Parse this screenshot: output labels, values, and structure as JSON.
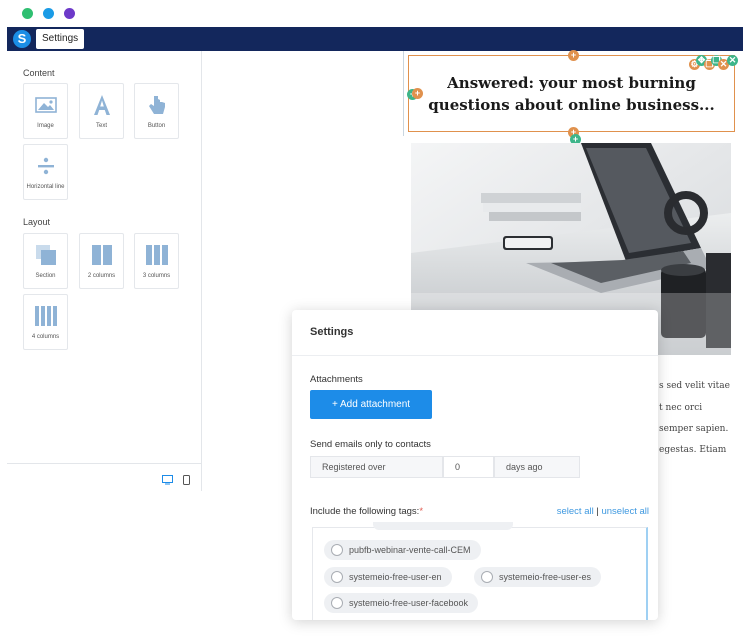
{
  "window": {
    "dots": [
      {
        "name": "green-dot",
        "color": "#2fbf71"
      },
      {
        "name": "blue-dot",
        "color": "#1a9be6"
      },
      {
        "name": "purple-dot",
        "color": "#6d39c9"
      }
    ]
  },
  "topbar": {
    "logo_letter": "S",
    "tab_label": "Settings",
    "color": "#13275c"
  },
  "sidebar": {
    "content_title": "Content",
    "content_blocks": [
      {
        "label": "Image",
        "icon": "image-icon"
      },
      {
        "label": "Text",
        "icon": "text-icon"
      },
      {
        "label": "Button",
        "icon": "pointer-icon"
      },
      {
        "label": "Horizontal line",
        "icon": "divider-icon"
      }
    ],
    "layout_title": "Layout",
    "layout_blocks": [
      {
        "label": "Section",
        "icon": "section-icon"
      },
      {
        "label": "2 columns",
        "icon": "two-columns-icon"
      },
      {
        "label": "3 columns",
        "icon": "three-columns-icon"
      },
      {
        "label": "4 columns",
        "icon": "four-columns-icon"
      }
    ],
    "footer_icons": [
      "desktop-icon",
      "mobile-icon"
    ]
  },
  "canvas": {
    "headline": "Answered: your most burning questions about online business...",
    "body_fragments": [
      "s sed velit vitae",
      "t nec orci",
      "semper sapien.",
      "egestas. Etiam"
    ],
    "accent_color": "#e0914d"
  },
  "settings_modal": {
    "title": "Settings",
    "attachments_label": "Attachments",
    "add_attachment_label": "+ Add attachment",
    "send_label": "Send emails only to contacts",
    "registered_label": "Registered over",
    "registered_value": "0",
    "days_label": "days ago",
    "tags_label": "Include the following tags:",
    "required_mark": "*",
    "select_all": "select all",
    "separator": "|",
    "unselect_all": "unselect all",
    "tags": [
      "pubfb-webinar-vente-call-CEM",
      "systemeio-free-user-en",
      "systemeio-free-user-es",
      "systemeio-free-user-facebook"
    ],
    "button_color": "#1d8ce8"
  }
}
